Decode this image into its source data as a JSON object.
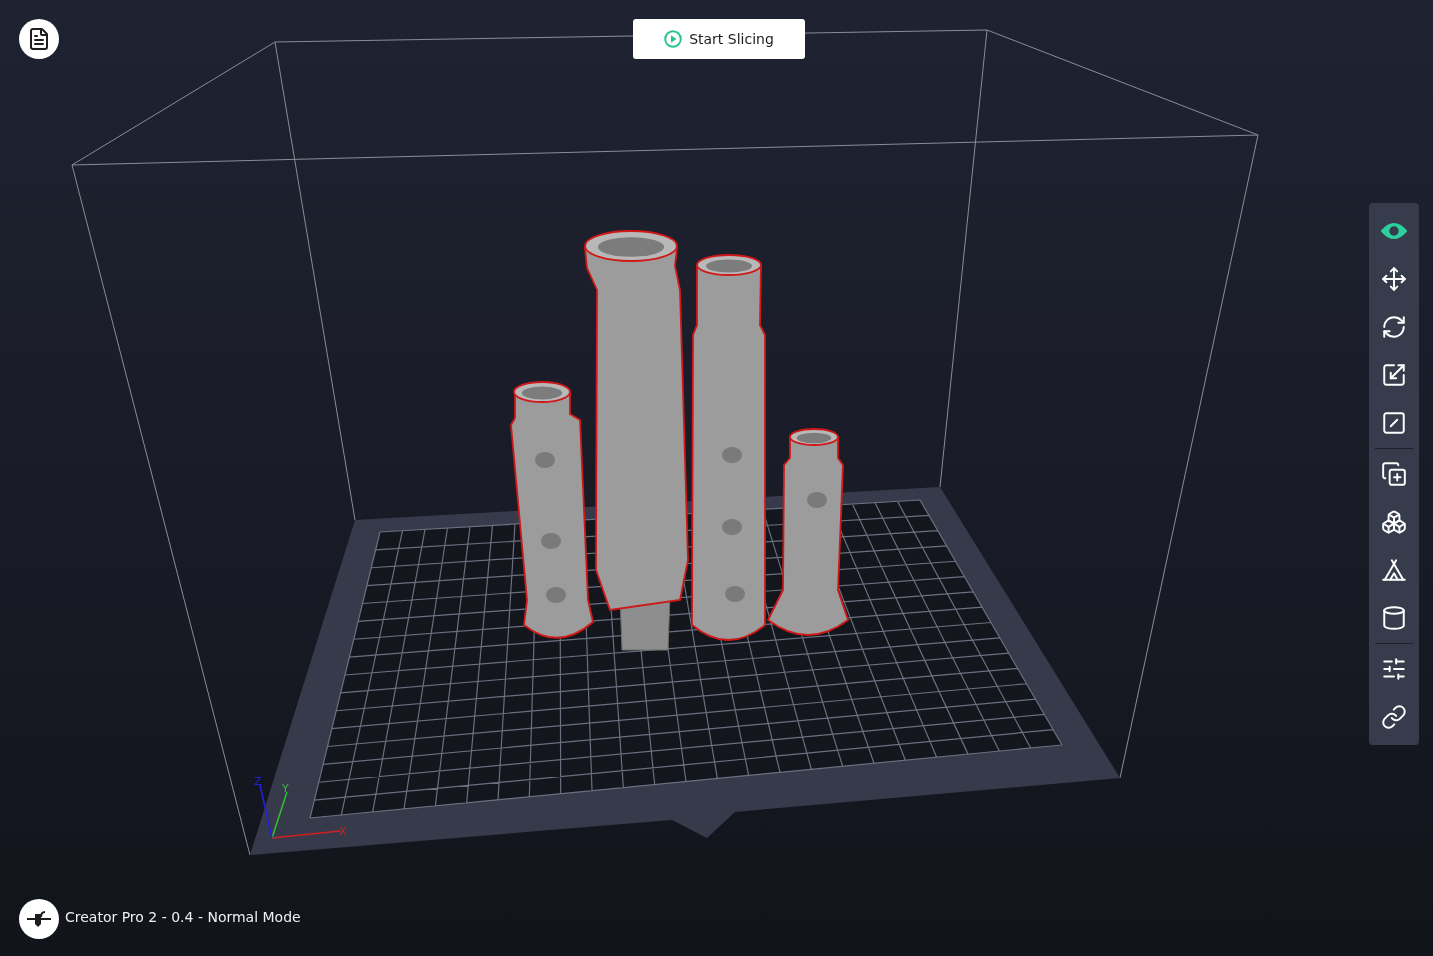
{
  "start_button": {
    "label": "Start Slicing"
  },
  "toolbar": {
    "groups": [
      [
        {
          "selected": true
        },
        {
          "selected": false
        },
        {
          "selected": false
        },
        {
          "selected": false
        },
        {
          "selected": false
        }
      ],
      [
        {
          "selected": false
        },
        {
          "selected": false
        },
        {
          "selected": false
        },
        {
          "selected": false
        }
      ],
      [
        {
          "selected": false
        },
        {
          "selected": false
        }
      ]
    ]
  },
  "axes": [
    {
      "label": "X"
    },
    {
      "label": "Y"
    },
    {
      "label": "Z"
    }
  ],
  "printer": {
    "label": "Creator Pro 2 - 0.4 - Normal Mode"
  }
}
